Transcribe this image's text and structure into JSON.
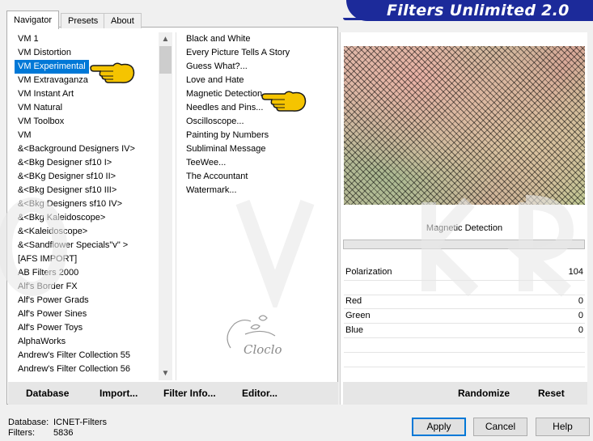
{
  "tabs": {
    "navigator": "Navigator",
    "presets": "Presets",
    "about": "About"
  },
  "banner": {
    "title": "Filters Unlimited 2.0"
  },
  "categories": [
    "VM 1",
    "VM Distortion",
    "VM Experimental",
    "VM Extravaganza",
    "VM Instant Art",
    "VM Natural",
    "VM Toolbox",
    "VM",
    "&<Background Designers IV>",
    "&<Bkg Designer sf10 I>",
    "&<BKg Designer sf10 II>",
    "&<Bkg Designer sf10 III>",
    "&<Bkg Designers sf10 IV>",
    "&<Bkg Kaleidoscope>",
    "&<Kaleidoscope>",
    "&<Sandflower Specials\"v\" >",
    "[AFS IMPORT]",
    "AB Filters 2000",
    "Alf's Border FX",
    "Alf's Power Grads",
    "Alf's Power Sines",
    "Alf's Power Toys",
    "AlphaWorks",
    "Andrew's Filter Collection 55",
    "Andrew's Filter Collection 56"
  ],
  "selected_category_index": 2,
  "filters": [
    "Black and White",
    "Every Picture Tells A Story",
    "Guess  What?...",
    "Love and Hate",
    "Magnetic Detection",
    "Needles and Pins...",
    "Oscilloscope...",
    "Painting by Numbers",
    "Subliminal Message",
    "TeeWee...",
    "The Accountant",
    "Watermark..."
  ],
  "params": {
    "filter_name": "Magnetic Detection",
    "sliders": [
      {
        "label": "Polarization",
        "value": "104"
      },
      {
        "label": "Red",
        "value": "0"
      },
      {
        "label": "Green",
        "value": "0"
      },
      {
        "label": "Blue",
        "value": "0"
      }
    ]
  },
  "toolbar": {
    "database": "Database",
    "import": "Import...",
    "filter_info": "Filter Info...",
    "editor": "Editor...",
    "randomize": "Randomize",
    "reset": "Reset"
  },
  "status": {
    "database_key": "Database:",
    "database_value": "ICNET-Filters",
    "filters_key": "Filters:",
    "filters_value": "5836"
  },
  "dialog": {
    "apply": "Apply",
    "cancel": "Cancel",
    "help": "Help"
  },
  "watermark": {
    "logo_text": "Cloclo"
  },
  "colors": {
    "banner": "#1c2a9a",
    "selection": "#0078d7",
    "hand": "#f5c400"
  }
}
